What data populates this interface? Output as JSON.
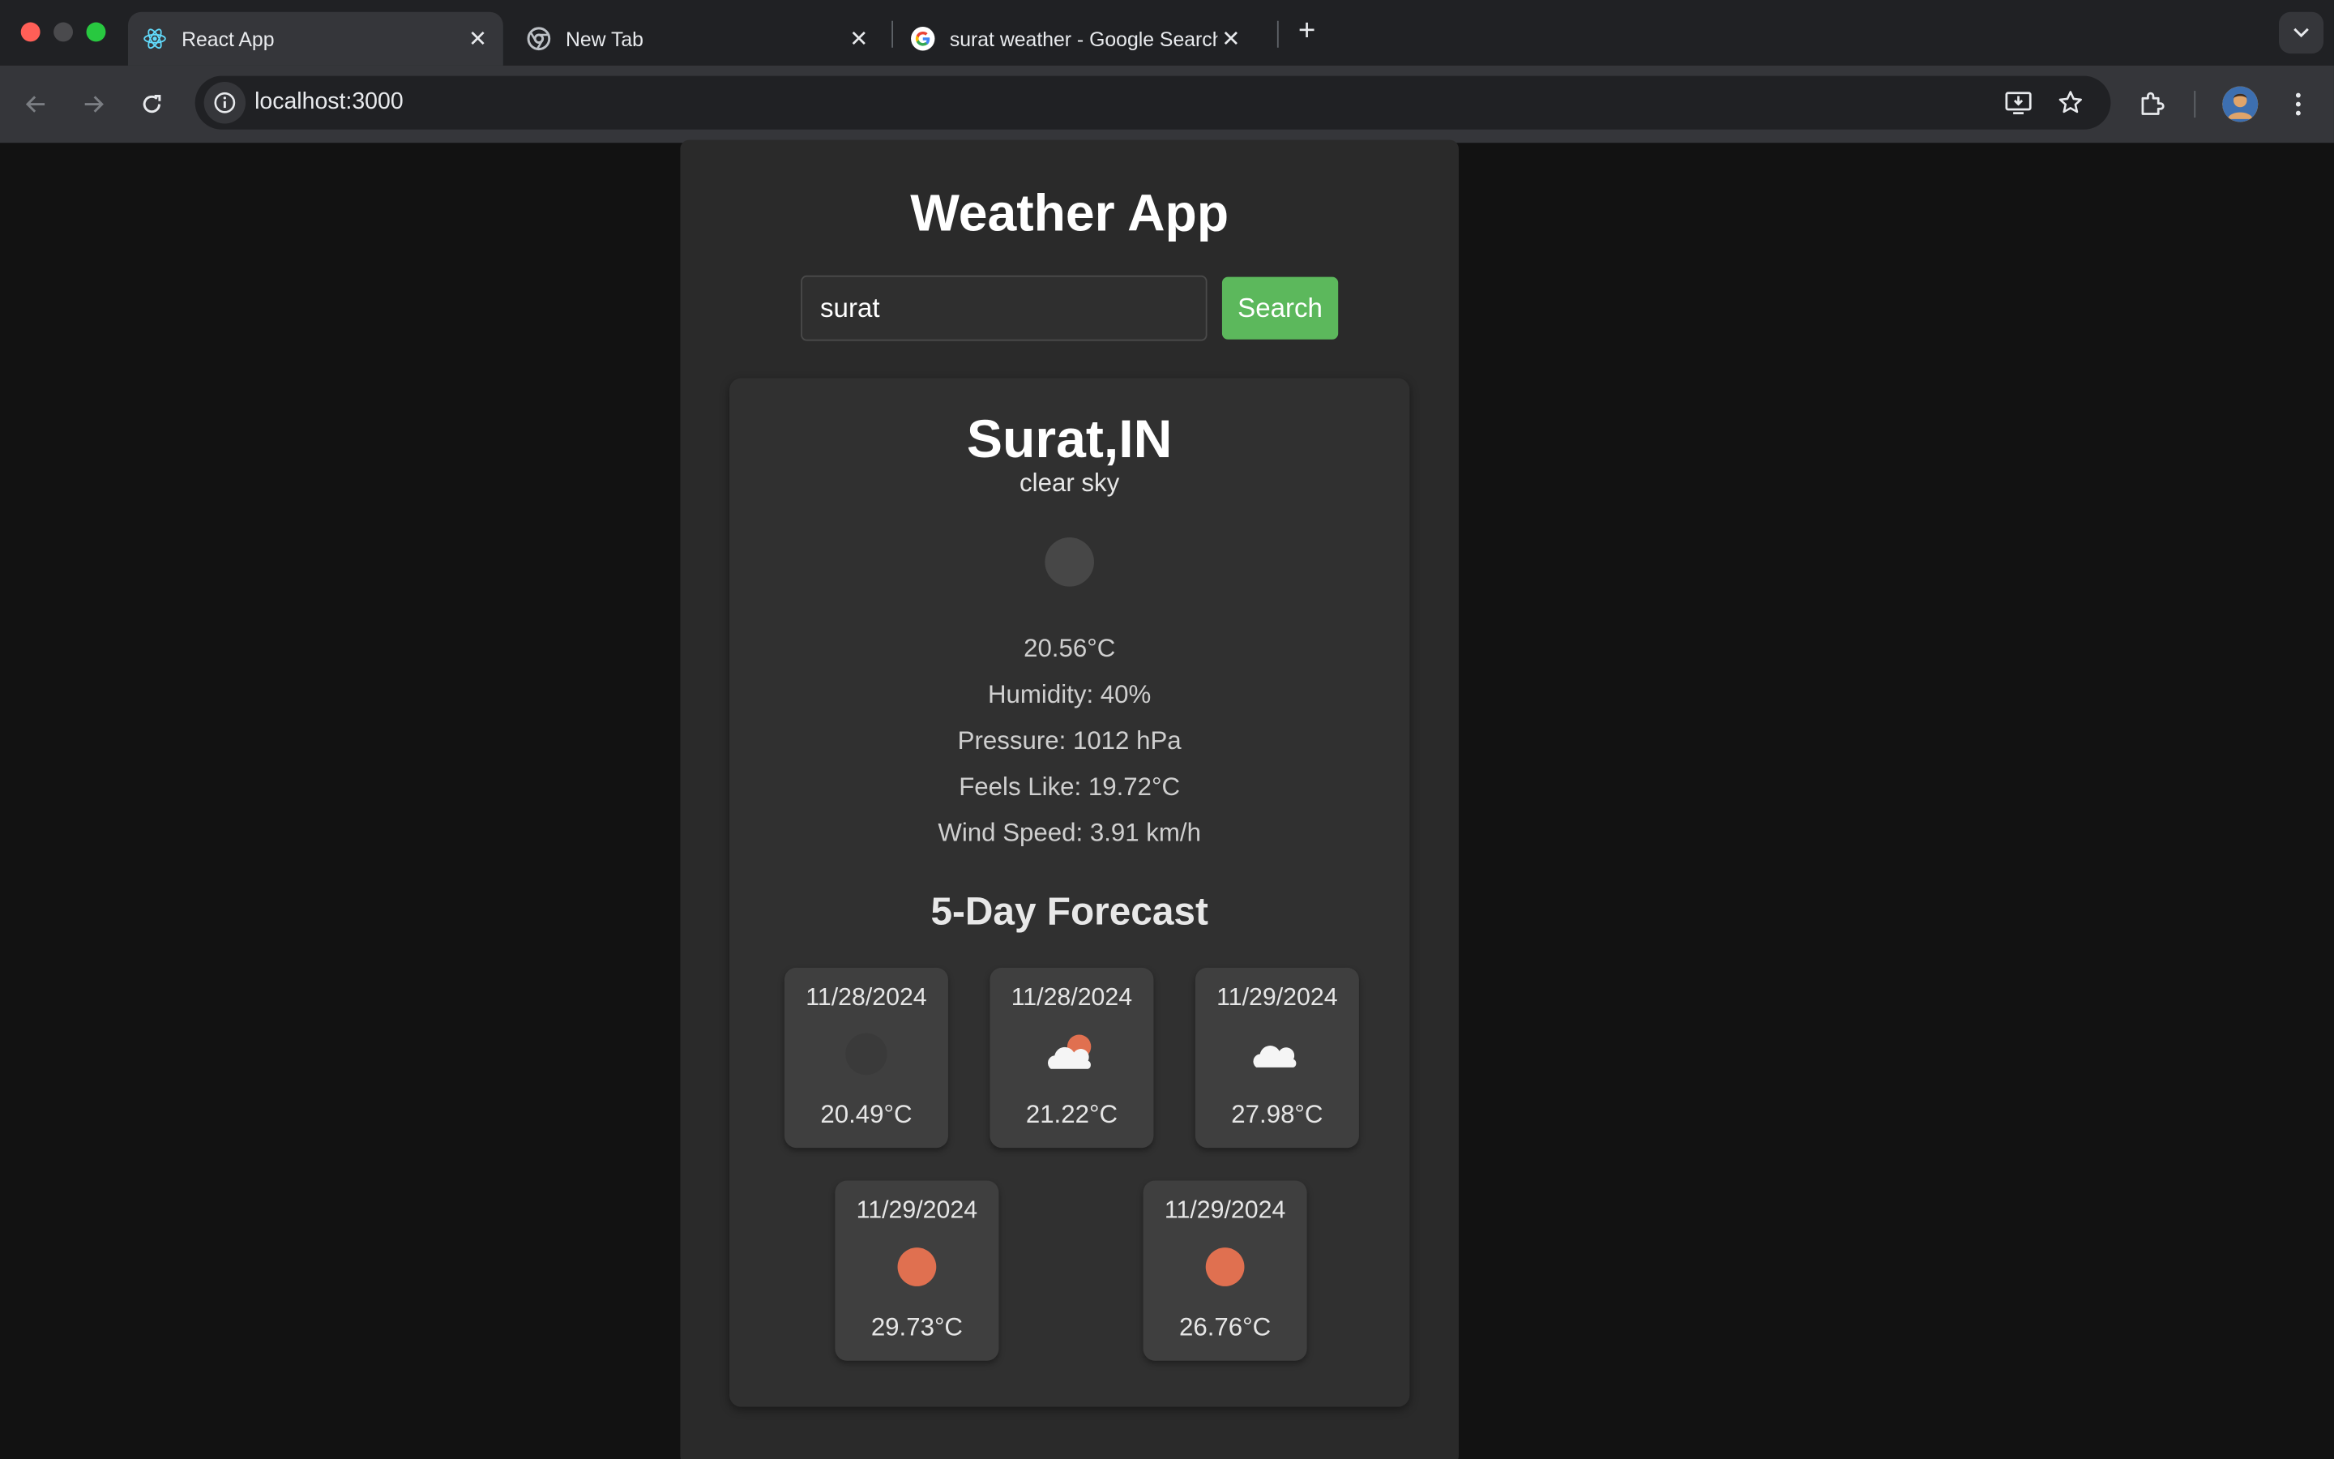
{
  "browser": {
    "tabs": [
      {
        "label": "React App",
        "icon": "react-icon",
        "active": true
      },
      {
        "label": "New Tab",
        "icon": "chrome-icon",
        "active": false
      },
      {
        "label": "surat weather - Google Search",
        "icon": "google-icon",
        "active": false
      }
    ],
    "url": "localhost:3000"
  },
  "app": {
    "title": "Weather App",
    "search": {
      "value": "surat",
      "placeholder": "",
      "button_label": "Search"
    },
    "current": {
      "city": "Surat,IN",
      "description": "clear sky",
      "icon": "clear-sky-icon",
      "temperature": "20.56°C",
      "humidity": "Humidity: 40%",
      "pressure": "Pressure: 1012 hPa",
      "feels_like": "Feels Like: 19.72°C",
      "wind_speed": "Wind Speed: 3.91 km/h"
    },
    "forecast_title": "5-Day Forecast",
    "forecast": [
      {
        "date": "11/28/2024",
        "temp": "20.49°C",
        "icon": "night-clear-icon"
      },
      {
        "date": "11/28/2024",
        "temp": "21.22°C",
        "icon": "partly-cloudy-icon"
      },
      {
        "date": "11/29/2024",
        "temp": "27.98°C",
        "icon": "cloud-icon"
      },
      {
        "date": "11/29/2024",
        "temp": "29.73°C",
        "icon": "sun-icon"
      },
      {
        "date": "11/29/2024",
        "temp": "26.76°C",
        "icon": "sun-icon"
      }
    ]
  },
  "colors": {
    "accent": "#5cb85c",
    "sun": "#e07050",
    "background": "#121212",
    "panel": "#2a2a2a"
  }
}
